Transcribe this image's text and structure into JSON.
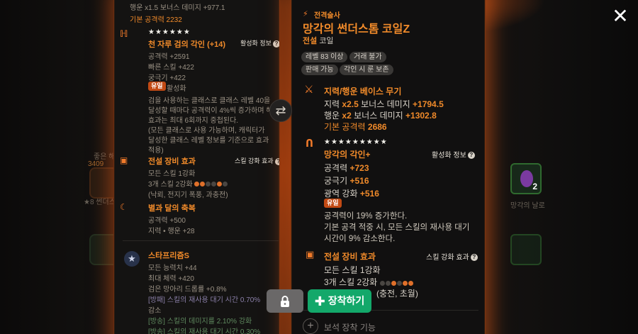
{
  "left_card": {
    "top_lines": [
      {
        "text": "행운 x1.5 보너스 데미지 +977.1",
        "color": "grey"
      },
      {
        "text": "기본 공격력 2232",
        "color": "orange"
      }
    ],
    "engrave_title": "천 자루 검의 각인 (+14)",
    "stars": "★★★★★★",
    "activation_info": "활성화 정보",
    "stats": [
      "공격력 +2591",
      "빠른 스킬 +422",
      "궁극기 +422"
    ],
    "unique_badge": "유일",
    "unique_status": "활성화",
    "desc_lines": [
      "검을 사용하는 클래스로 클래스 레벨 40을",
      "달성할 때마다 공격력이 4%씩 증가하며 해당",
      "효과는 최대 6회까지 중첩된다.",
      "(모든 클래스로 사용 가능하며, 캐릭터가",
      "달성한 클래스 레벨 정보를 기준으로 효과",
      "적용)"
    ],
    "legend_title": "전설 장비 효과",
    "skill_effect_info": "스킬 강화 효과",
    "legend_lines": [
      "모든 스킬 1강화",
      "3개 스킬 2강화",
      "(낙뢰, 전지기 폭풍, 과충전)"
    ],
    "moon_title": "별과 달의 축복",
    "moon_lines": [
      "공격력 +500",
      "지력 • 행운 +28"
    ],
    "star_title": "스타프리즘S",
    "star_lines": [
      "모든 능력치 +44",
      "최대 체력 +420",
      "검은 망아리 드롭률 +0.8%",
      "[방패] 스킬의 재사용 대기 시간 0.70%",
      "감소",
      "[방송] 스킬의 데미지를 2.10% 강화",
      "[방송] 스킬의 재사용 대기 시간 0.30%"
    ]
  },
  "right_card": {
    "class_label": "전격술사",
    "item_name": "망각의 썬더스톰 코일Z",
    "grade": "전설",
    "type": "코일",
    "tags": [
      "레벨 83 이상",
      "거래 불가",
      "판매 가능",
      "각인 시 룬 보존"
    ],
    "weapon_title": "지력/행운 베이스 무기",
    "weapon_lines": [
      {
        "prefix": "지력 ",
        "bold": "x2.5",
        "mid": " 보너스 데미지 ",
        "value": "+1794.5"
      },
      {
        "prefix": "행운 ",
        "bold": "x2",
        "mid": " 보너스 데미지 ",
        "value": "+1302.8"
      }
    ],
    "base_attack_label": "기본 공격력",
    "base_attack_value": "2686",
    "stars": "★★★★★★★★★",
    "engrave_title": "망각의 각인+",
    "activation_info": "활성화 정보",
    "engrave_stats": [
      {
        "label": "공격력 ",
        "value": "+723"
      },
      {
        "label": "궁극기 ",
        "value": "+516"
      },
      {
        "label": "광역 강화 ",
        "value": "+516"
      }
    ],
    "unique_badge": "유일",
    "unique_desc": [
      "공격력이 19% 증가한다.",
      "기본 공격 적중 시, 모든 스킬의 재사용 대기",
      "시간이 9% 감소한다."
    ],
    "legend_title": "전설 장비 효과",
    "skill_effect_info": "스킬 강화 효과",
    "legend_line1": "모든 스킬 1강화",
    "legend_line2": "3개 스킬 2강화",
    "legend_line3": "(충전, 초월)",
    "gem_slot_label": "보석 장착 기능"
  },
  "buttons": {
    "equip": "장착하기",
    "lock_icon": "lock-icon",
    "swap_icon": "swap-icon",
    "close_icon": "close-icon"
  },
  "background": {
    "left_item_stat": "3409",
    "left_item_label": "★8 썬더스톰",
    "left_item_label2": "좋은 해",
    "right_item_count": "2",
    "right_item_label": "망각의 날로"
  },
  "colors": {
    "accent_orange": "#f08a2a",
    "equip_green": "#13a86a",
    "glow": "#d2501a"
  }
}
